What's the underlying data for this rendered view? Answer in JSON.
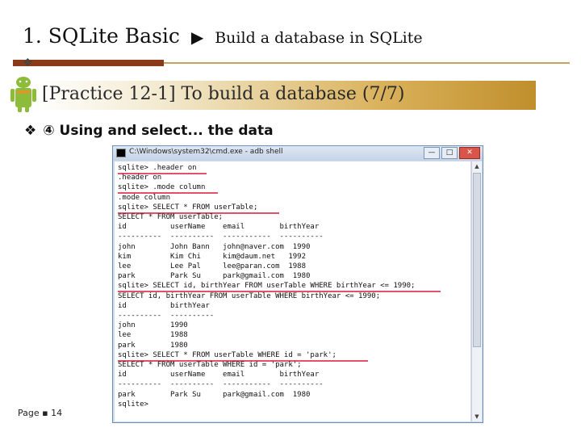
{
  "slide": {
    "title_main": "1. SQLite Basic",
    "title_arrow": "▶",
    "title_sub": "Build a database in SQLite",
    "practice_title": "[Practice 12-1] To build a database (7/7)",
    "point_bullet": "❖",
    "point_text": "④ Using and select... the data",
    "page_number": "Page ▪ 14"
  },
  "window": {
    "title": "C:\\Windows\\system32\\cmd.exe - adb  shell",
    "controls": {
      "minimize": "—",
      "maximize": "□",
      "close": "✕"
    }
  },
  "console_lines": [
    "sqlite> .header on",
    ".header on",
    "sqlite> .mode column",
    ".mode column",
    "sqlite> SELECT * FROM userTable;",
    "SELECT * FROM userTable;",
    "id          userName    email        birthYear",
    "----------  ----------  -----------  ----------",
    "john        John Bann   john@naver.com  1990",
    "kim         Kim Chi     kim@daum.net   1992",
    "lee         Lee Pal     lee@paran.com  1988",
    "park        Park Su     park@gmail.com  1980",
    "sqlite> SELECT id, birthYear FROM userTable WHERE birthYear <= 1990;",
    "SELECT id, birthYear FROM userTable WHERE birthYear <= 1990;",
    "id          birthYear",
    "----------  ----------",
    "john        1990",
    "lee         1988",
    "park        1980",
    "sqlite> SELECT * FROM userTable WHERE id = 'park';",
    "SELECT * FROM userTable WHERE id = 'park';",
    "id          userName    email        birthYear",
    "----------  ----------  -----------  ----------",
    "park        Park Su     park@gmail.com  1980",
    "sqlite>"
  ]
}
